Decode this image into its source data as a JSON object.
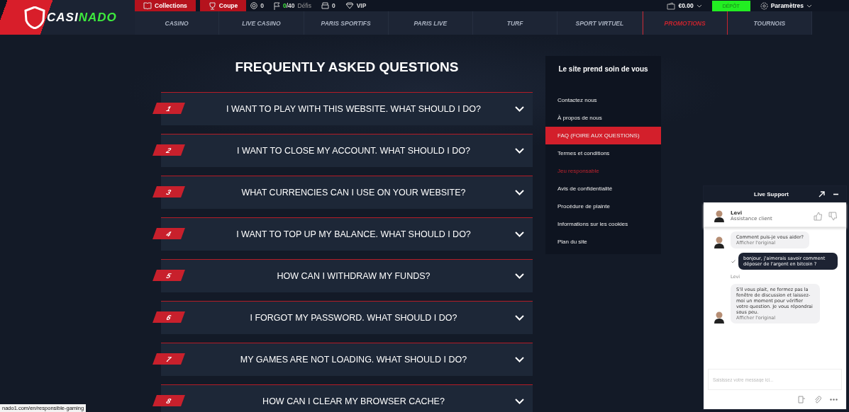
{
  "logo": {
    "initial": "C",
    "white_part": "ASI",
    "green_part": "NADO"
  },
  "top_bar": {
    "links": [
      {
        "label": "Collections"
      },
      {
        "label": "Coupe"
      }
    ],
    "counters": [
      {
        "value": "0"
      },
      {
        "value": "0",
        "total": "/40",
        "label": "Défis"
      },
      {
        "value": "0"
      },
      {
        "value": "VIP"
      }
    ],
    "balance": "€0.00",
    "deposit_button": "DÉPÔT",
    "settings": "Paramètres"
  },
  "nav": [
    {
      "label": "CASINO",
      "selected": false
    },
    {
      "label": "LIVE CASINO",
      "selected": false
    },
    {
      "label": "PARIS SPORTIFS",
      "selected": false
    },
    {
      "label": "PARIS LIVE",
      "selected": false
    },
    {
      "label": "TURF",
      "selected": false
    },
    {
      "label": "SPORT VIRTUEL",
      "selected": false
    },
    {
      "label": "PROMOTIONS",
      "selected": true
    },
    {
      "label": "TOURNOIS",
      "selected": false
    }
  ],
  "faq": {
    "title": "FREQUENTLY ASKED QUESTIONS",
    "items": [
      {
        "number": "1",
        "question": "I WANT TO PLAY WITH THIS WEBSITE. WHAT SHOULD I DO?"
      },
      {
        "number": "2",
        "question": "I WANT TO CLOSE MY ACCOUNT. WHAT SHOULD I DO?"
      },
      {
        "number": "3",
        "question": "WHAT CURRENCIES CAN I USE ON YOUR WEBSITE?"
      },
      {
        "number": "4",
        "question": "I WANT TO TOP UP MY BALANCE. WHAT SHOULD I DO?"
      },
      {
        "number": "5",
        "question": "HOW CAN I WITHDRAW MY FUNDS?"
      },
      {
        "number": "6",
        "question": "I FORGOT MY PASSWORD. WHAT SHOULD I DO?"
      },
      {
        "number": "7",
        "question": "MY GAMES ARE NOT LOADING. WHAT SHOULD I DO?"
      },
      {
        "number": "8",
        "question": "HOW CAN I CLEAR MY BROWSER CACHE?"
      }
    ]
  },
  "sidebar": {
    "title": "Le site prend soin de vous",
    "items": [
      {
        "label": "Contactez nous",
        "selected": false,
        "hovered": false
      },
      {
        "label": "À propos de nous",
        "selected": false,
        "hovered": false
      },
      {
        "label": "FAQ (FOIRE AUX QUESTIONS)",
        "selected": true,
        "hovered": false
      },
      {
        "label": "Termes et conditions",
        "selected": false,
        "hovered": false
      },
      {
        "label": "Jeu responsable",
        "selected": false,
        "hovered": true
      },
      {
        "label": "Avis de confidentialité",
        "selected": false,
        "hovered": false
      },
      {
        "label": "Procédure de plainte",
        "selected": false,
        "hovered": false
      },
      {
        "label": "Informations sur les cookies",
        "selected": false,
        "hovered": false
      },
      {
        "label": "Plan du site",
        "selected": false,
        "hovered": false
      }
    ]
  },
  "chat": {
    "title": "Live Support",
    "agent": {
      "name": "Levi",
      "role": "Assistance client"
    },
    "messages": [
      {
        "kind": "agent",
        "text": "Comment puis-je vous aider?",
        "link": "Afficher l'original"
      },
      {
        "kind": "user",
        "text": "bonjour, j'aimerais savoir comment déposer de l'argent en bitcoin ?"
      },
      {
        "kind": "agent",
        "sender": "Levi",
        "text": "S'il vous plait, ne fermez pas la fenêtre de discussion et laissez-moi un moment pour vérifier votre question. Je vous répondrai sous peu.",
        "link": "Afficher l'original"
      }
    ],
    "input": {
      "placeholder": "Saisissez votre message ici..."
    }
  },
  "status_bar": {
    "url": "nado1.com/en/responsible-gaming"
  }
}
